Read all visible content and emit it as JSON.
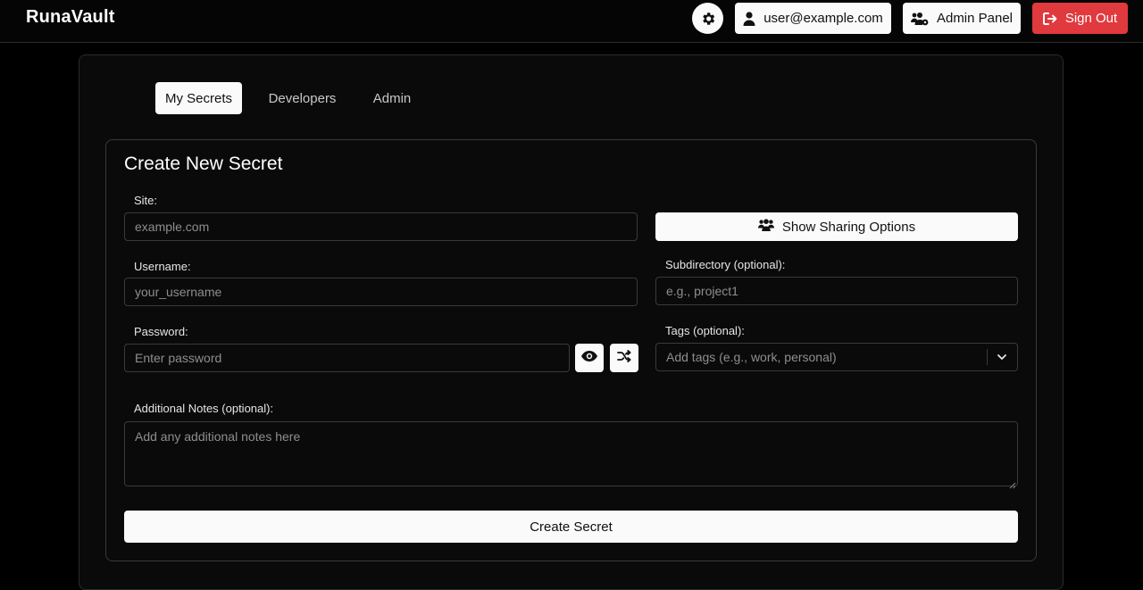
{
  "app": {
    "brand": "RunaVault"
  },
  "header": {
    "theme_icon": "gear-icon",
    "user_label": "user@example.com",
    "user_icon": "user-icon",
    "admin_label": "Admin Panel",
    "admin_icon": "users-gear-icon",
    "signout_label": "Sign Out",
    "signout_icon": "sign-out-icon",
    "signout_color": "#e0393e"
  },
  "tabs": [
    {
      "label": "My Secrets",
      "active": true
    },
    {
      "label": "Developers",
      "active": false
    },
    {
      "label": "Admin",
      "active": false
    }
  ],
  "form": {
    "title": "Create New Secret",
    "site": {
      "label": "Site:",
      "placeholder": "example.com",
      "value": ""
    },
    "share_button": {
      "label": "Show Sharing Options",
      "icon": "users-icon"
    },
    "username": {
      "label": "Username:",
      "placeholder": "your_username",
      "value": ""
    },
    "subdirectory": {
      "label": "Subdirectory (optional):",
      "placeholder": "e.g., project1",
      "value": ""
    },
    "password": {
      "label": "Password:",
      "placeholder": "Enter password",
      "value": "",
      "show_icon": "eye-icon",
      "generate_icon": "shuffle-icon"
    },
    "tags": {
      "label": "Tags (optional):",
      "placeholder": "Add tags (e.g., work, personal)",
      "value": ""
    },
    "notes": {
      "label": "Additional Notes (optional):",
      "placeholder": "Add any additional notes here",
      "value": ""
    },
    "submit_label": "Create Secret"
  }
}
